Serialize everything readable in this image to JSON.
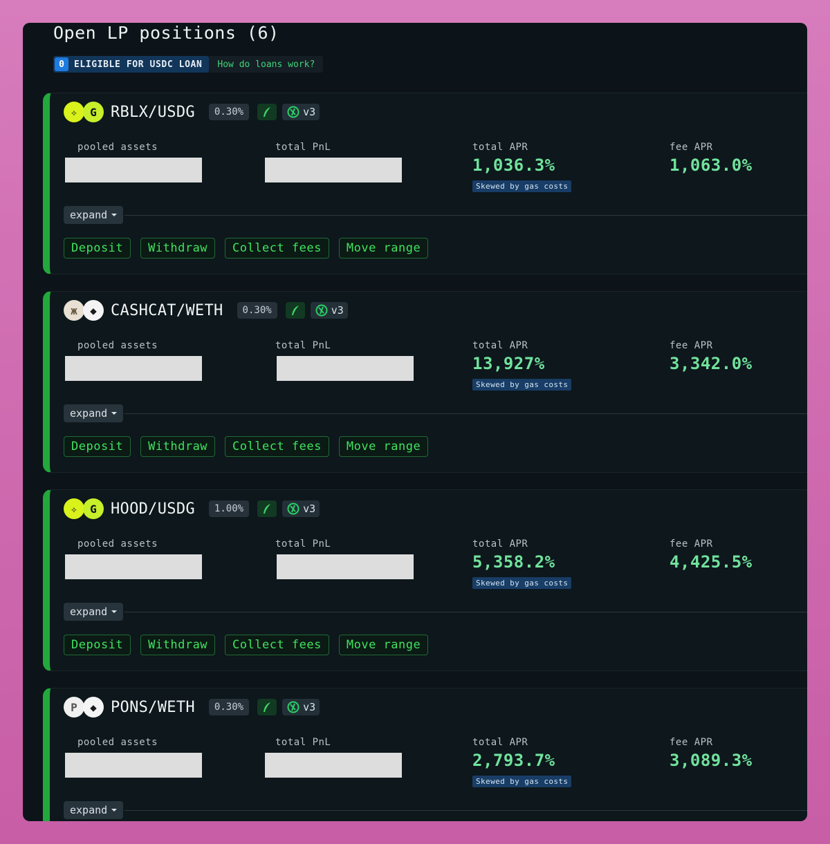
{
  "header": {
    "title": "Open LP positions (6)",
    "loan_count": "0",
    "loan_label": "ELIGIBLE FOR USDC LOAN",
    "loan_link": "How do loans work?"
  },
  "labels": {
    "pooled_assets": "pooled assets",
    "total_pnl": "total PnL",
    "total_apr": "total APR",
    "fee_apr": "fee APR",
    "skew_note": "Skewed by gas costs",
    "expand": "expand",
    "version": "v3"
  },
  "actions": {
    "deposit": "Deposit",
    "withdraw": "Withdraw",
    "collect": "Collect fees",
    "move": "Move range"
  },
  "positions": [
    {
      "pair": "RBLX/USDG",
      "fee_tier": "0.30%",
      "total_apr": "1,036.3%",
      "fee_apr": "1,063.0%",
      "token0_icon": "leaf-icon",
      "token1_icon": "g-coin-icon"
    },
    {
      "pair": "CASHCAT/WETH",
      "fee_tier": "0.30%",
      "total_apr": "13,927%",
      "fee_apr": "3,342.0%",
      "token0_icon": "cat-icon",
      "token1_icon": "eth-icon"
    },
    {
      "pair": "HOOD/USDG",
      "fee_tier": "1.00%",
      "total_apr": "5,358.2%",
      "fee_apr": "4,425.5%",
      "token0_icon": "leaf-icon",
      "token1_icon": "g-coin-icon"
    },
    {
      "pair": "PONS/WETH",
      "fee_tier": "0.30%",
      "total_apr": "2,793.7%",
      "fee_apr": "3,089.3%",
      "token0_icon": "p-token-icon",
      "token1_icon": "eth-icon"
    }
  ],
  "colors": {
    "accent_green": "#22a83c",
    "apr_green": "#71e29c",
    "button_green": "#40e35f",
    "loan_blue": "#1e7be0"
  }
}
